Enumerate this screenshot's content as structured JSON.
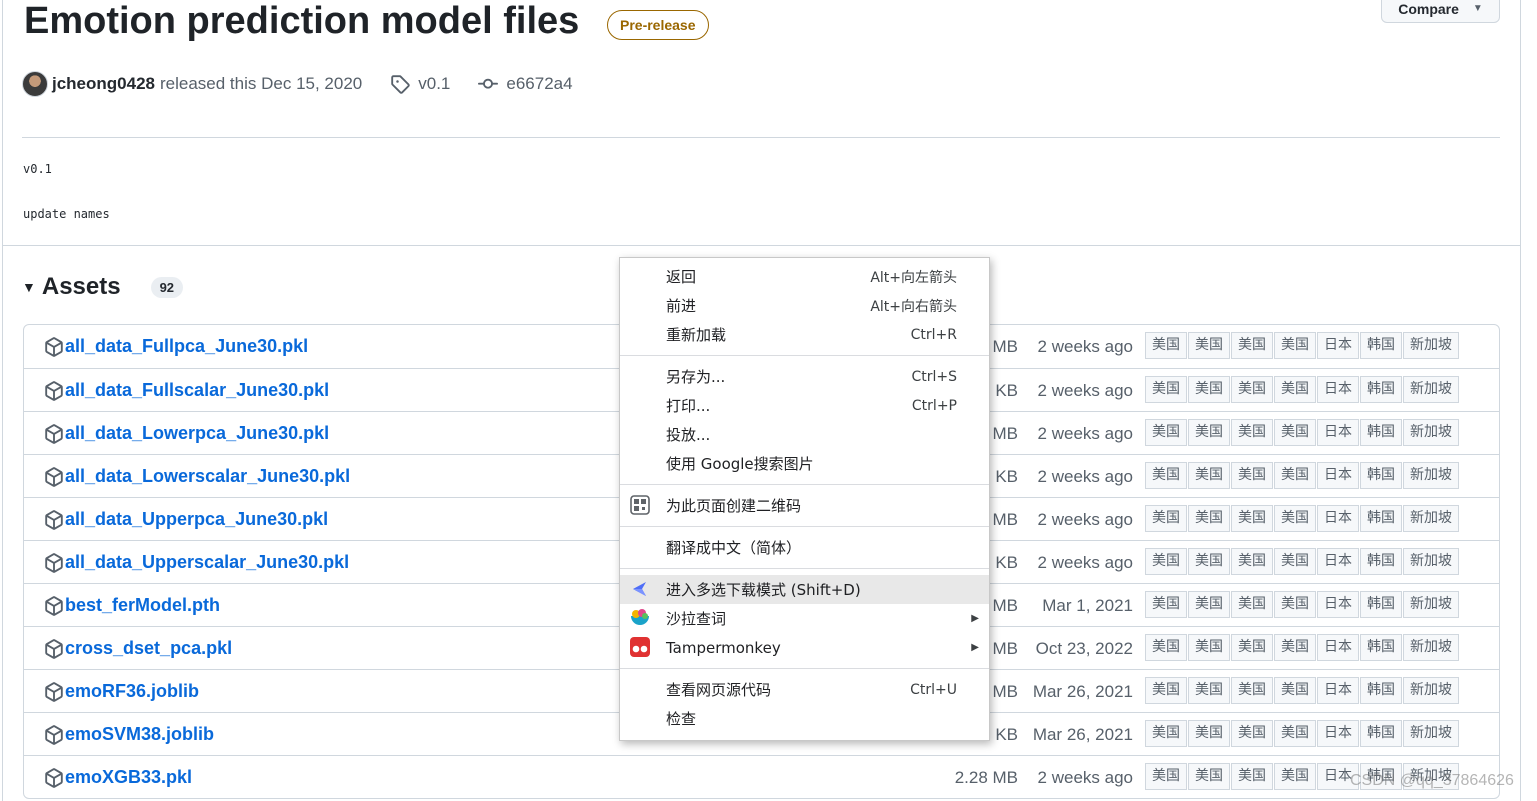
{
  "release": {
    "title": "Emotion prediction model files",
    "badge": "Pre-release",
    "compare_label": "Compare",
    "author": "jcheong0428",
    "released_text": "released this Dec 15, 2020",
    "tag": "v0.1",
    "commit": "e6672a4",
    "body_lines": [
      "v0.1",
      "update names"
    ]
  },
  "assets": {
    "heading": "Assets",
    "count": "92",
    "mirror_labels": [
      "美国",
      "美国",
      "美国",
      "美国",
      "日本",
      "韩国",
      "新加坡"
    ],
    "rows": [
      {
        "name": "all_data_Fullpca_June30.pkl",
        "size": "MB",
        "date": "2 weeks ago"
      },
      {
        "name": "all_data_Fullscalar_June30.pkl",
        "size": "7 KB",
        "date": "2 weeks ago"
      },
      {
        "name": "all_data_Lowerpca_June30.pkl",
        "size": "MB",
        "date": "2 weeks ago"
      },
      {
        "name": "all_data_Lowerscalar_June30.pkl",
        "size": "7 KB",
        "date": "2 weeks ago"
      },
      {
        "name": "all_data_Upperpca_June30.pkl",
        "size": "MB",
        "date": "2 weeks ago"
      },
      {
        "name": "all_data_Upperscalar_June30.pkl",
        "size": "7 KB",
        "date": "2 weeks ago"
      },
      {
        "name": "best_ferModel.pth",
        "size": "MB",
        "date": "Mar 1, 2021"
      },
      {
        "name": "cross_dset_pca.pkl",
        "size": "MB",
        "date": "Oct 23, 2022"
      },
      {
        "name": "emoRF36.joblib",
        "size": "MB",
        "date": "Mar 26, 2021"
      },
      {
        "name": "emoSVM38.joblib",
        "size": "KB",
        "date": "Mar 26, 2021"
      },
      {
        "name": "emoXGB33.pkl",
        "size": "2.28 MB",
        "date": "2 weeks ago"
      }
    ]
  },
  "context_menu": {
    "groups": [
      [
        {
          "label": "返回",
          "shortcut": "Alt+向左箭头"
        },
        {
          "label": "前进",
          "shortcut": "Alt+向右箭头"
        },
        {
          "label": "重新加载",
          "shortcut": "Ctrl+R"
        }
      ],
      [
        {
          "label": "另存为...",
          "shortcut": "Ctrl+S"
        },
        {
          "label": "打印...",
          "shortcut": "Ctrl+P"
        },
        {
          "label": "投放...",
          "shortcut": ""
        },
        {
          "label": "使用 Google搜索图片",
          "shortcut": ""
        }
      ],
      [
        {
          "label": "为此页面创建二维码",
          "shortcut": "",
          "icon": "qr-code-icon"
        }
      ],
      [
        {
          "label": "翻译成中文（简体）",
          "shortcut": ""
        }
      ],
      [
        {
          "label": "进入多选下载模式 (Shift+D)",
          "shortcut": "",
          "icon": "download-bird-icon",
          "highlighted": true
        },
        {
          "label": "沙拉查词",
          "shortcut": "",
          "icon": "saladict-icon",
          "submenu": true
        },
        {
          "label": "Tampermonkey",
          "shortcut": "",
          "icon": "tampermonkey-icon",
          "submenu": true
        }
      ],
      [
        {
          "label": "查看网页源代码",
          "shortcut": "Ctrl+U"
        },
        {
          "label": "检查",
          "shortcut": ""
        }
      ]
    ]
  },
  "watermark": "CSDN @qq_37864626",
  "colors": {
    "link": "#0969da",
    "prerelease": "#9a6700",
    "border": "#d0d7de",
    "muted": "#57606a"
  }
}
